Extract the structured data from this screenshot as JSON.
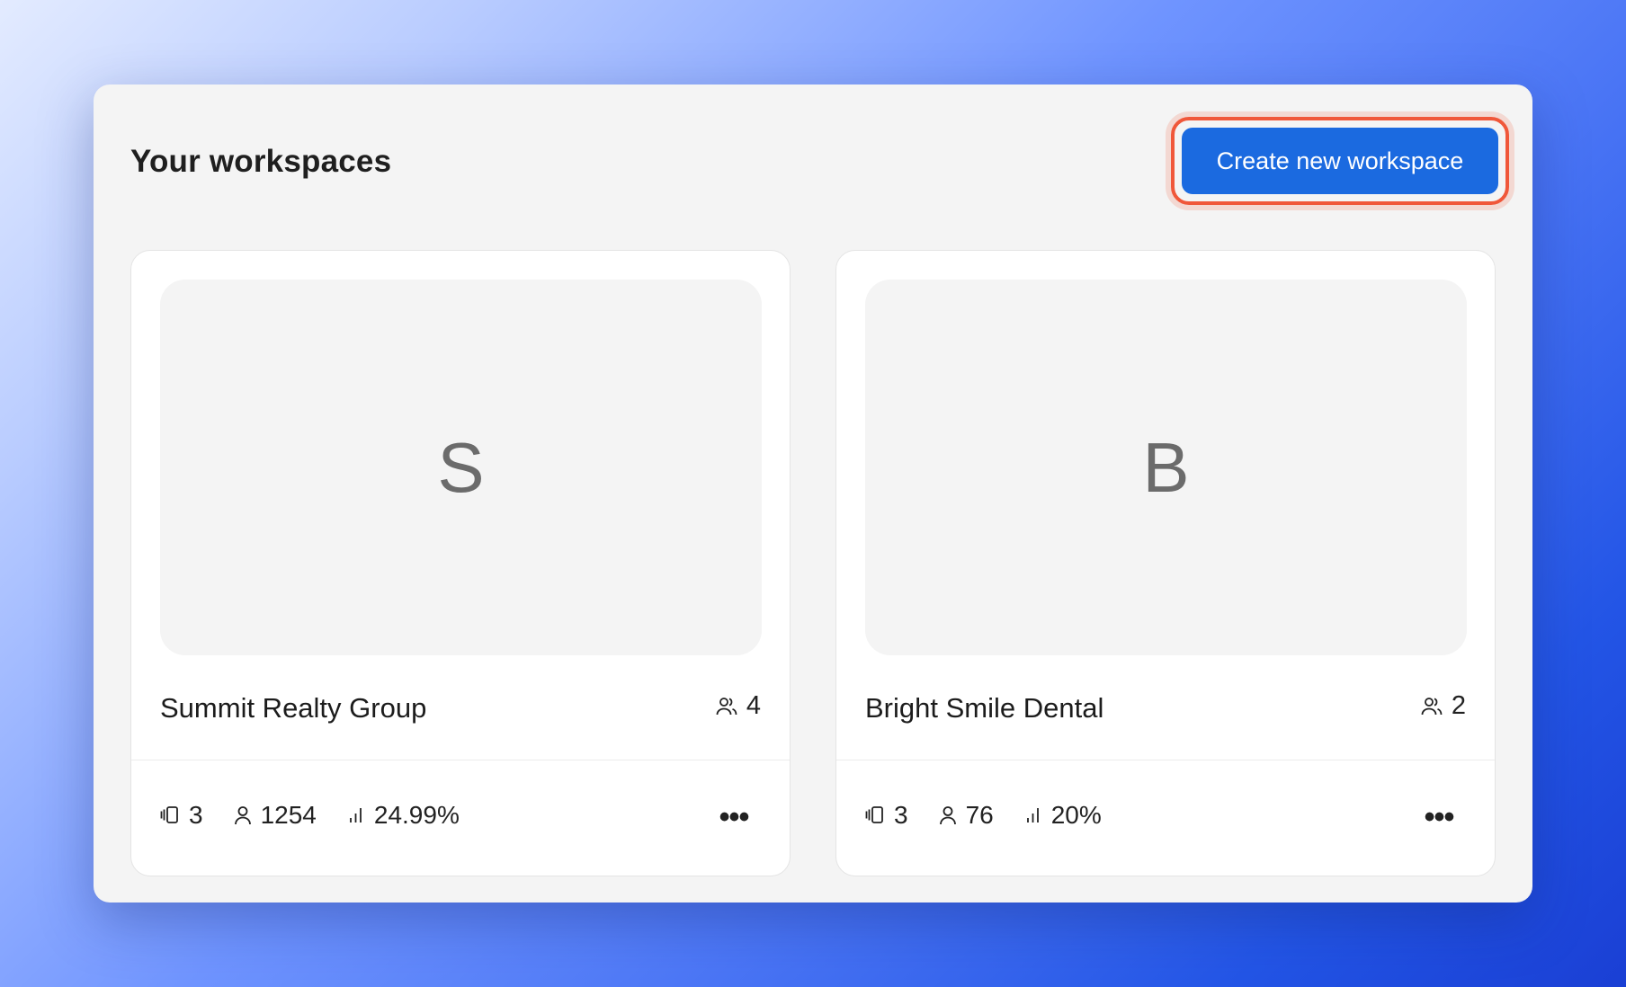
{
  "header": {
    "title": "Your workspaces",
    "create_button_label": "Create new workspace"
  },
  "highlight_color": "#f0573a",
  "accent_color": "#1b6ae0",
  "workspaces": [
    {
      "initial": "S",
      "name": "Summit Realty Group",
      "members": "4",
      "stats": {
        "items": "3",
        "contacts": "1254",
        "rate": "24.99%"
      },
      "members_icon": "users-icon",
      "items_icon": "cards-icon",
      "contacts_icon": "user-icon",
      "rate_icon": "bar-chart-icon"
    },
    {
      "initial": "B",
      "name": "Bright Smile Dental",
      "members": "2",
      "stats": {
        "items": "3",
        "contacts": "76",
        "rate": "20%"
      },
      "members_icon": "users-icon",
      "items_icon": "cards-icon",
      "contacts_icon": "user-icon",
      "rate_icon": "bar-chart-icon"
    }
  ],
  "more_label": "•••"
}
